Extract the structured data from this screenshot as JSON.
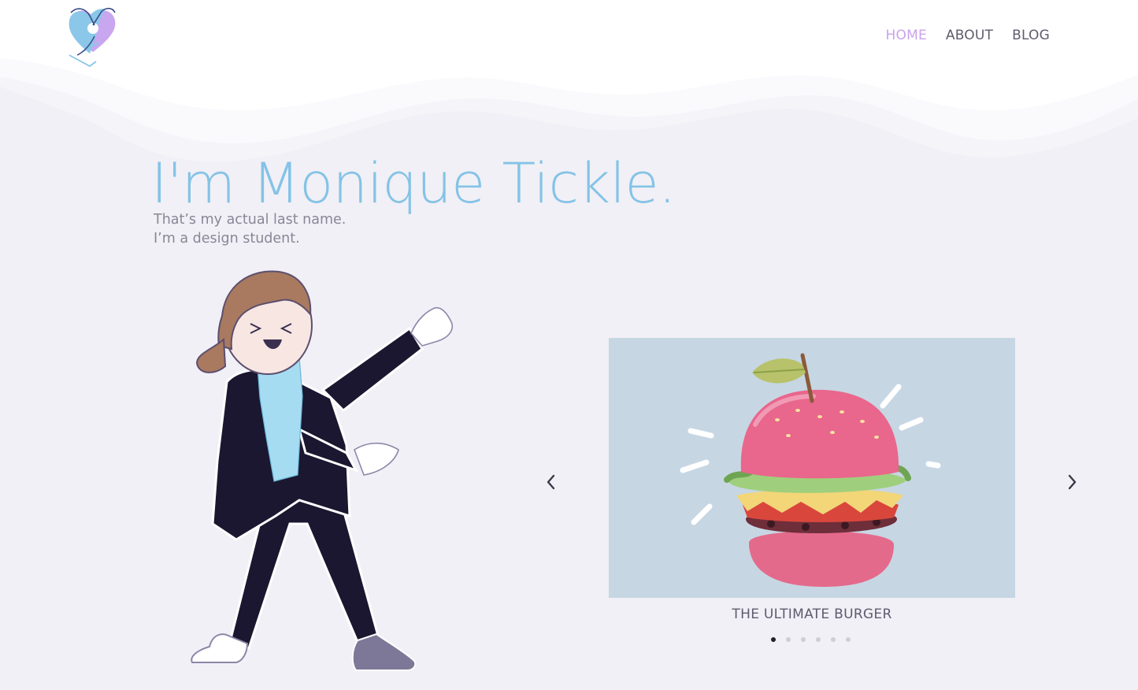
{
  "nav": {
    "items": [
      {
        "label": "HOME",
        "active": true
      },
      {
        "label": "ABOUT",
        "active": false
      },
      {
        "label": "BLOG",
        "active": false
      }
    ]
  },
  "hero": {
    "title": "I'm Monique Tickle.",
    "subtitle_line1": "That’s my actual last name.",
    "subtitle_line2": "I’m a design student."
  },
  "carousel": {
    "caption": "THE ULTIMATE BURGER",
    "slide_count": 6,
    "active_index": 0,
    "prev_icon": "chevron-left-icon",
    "next_icon": "chevron-right-icon"
  },
  "colors": {
    "accent_pink": "#c9a2ee",
    "title_blue": "#84c3e6",
    "background": "#f1f0f6"
  }
}
